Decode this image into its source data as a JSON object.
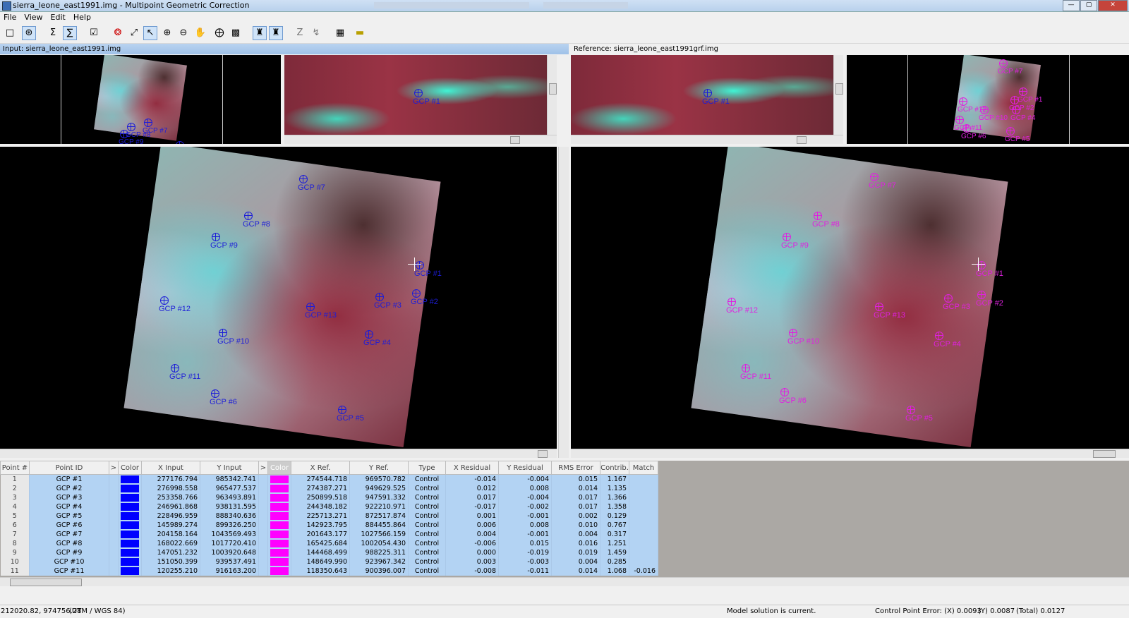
{
  "window": {
    "title": "sierra_leone_east1991.img - Multipoint Geometric Correction"
  },
  "menu": [
    "File",
    "View",
    "Edit",
    "Help"
  ],
  "toolbar_icons": [
    "new-window-icon",
    "viewer-sync-icon",
    "sum-icon",
    "model-properties-icon",
    "check-icon",
    "gcp-color-icon",
    "fit-icon",
    "select-arrow-icon",
    "zoom-in-icon",
    "zoom-out-icon",
    "pan-hand-icon",
    "create-gcp-icon",
    "lock-icon",
    "drive-to-input-icon",
    "drive-to-reference-icon",
    "z-value-icon",
    "z-options-icon",
    "table-icon",
    "measure-icon"
  ],
  "panels": {
    "input_header": "Input: sierra_leone_east1991.img",
    "reference_header": "Reference: sierra_leone_east1991grf.img"
  },
  "gcps": {
    "main_left": [
      {
        "label": "GCP #1"
      },
      {
        "label": "GCP #2"
      },
      {
        "label": "GCP #3"
      },
      {
        "label": "GCP #4"
      },
      {
        "label": "GCP #5"
      },
      {
        "label": "GCP #6"
      },
      {
        "label": "GCP #7"
      },
      {
        "label": "GCP #8"
      },
      {
        "label": "GCP #9"
      },
      {
        "label": "GCP #10"
      },
      {
        "label": "GCP #11"
      },
      {
        "label": "GCP #12"
      },
      {
        "label": "GCP #13"
      }
    ],
    "zoom_label": "GCP #1"
  },
  "table": {
    "headers": [
      "Point #",
      "Point ID",
      ">",
      "Color",
      "X Input",
      "Y Input",
      ">",
      "Color",
      "X Ref.",
      "Y Ref.",
      "Type",
      "X Residual",
      "Y Residual",
      "RMS Error",
      "Contrib.",
      "Match"
    ],
    "input_color": "#0000ff",
    "ref_color": "#ff00ff",
    "rows": [
      {
        "n": "1",
        "id": "GCP #1",
        "xi": "277176.794",
        "yi": "985342.741",
        "xr": "274544.718",
        "yr": "969570.782",
        "type": "Control",
        "xres": "-0.014",
        "yres": "-0.004",
        "rms": "0.015",
        "contrib": "1.167",
        "match": ""
      },
      {
        "n": "2",
        "id": "GCP #2",
        "xi": "276998.558",
        "yi": "965477.537",
        "xr": "274387.271",
        "yr": "949629.525",
        "type": "Control",
        "xres": "0.012",
        "yres": "0.008",
        "rms": "0.014",
        "contrib": "1.135",
        "match": ""
      },
      {
        "n": "3",
        "id": "GCP #3",
        "xi": "253358.766",
        "yi": "963493.891",
        "xr": "250899.518",
        "yr": "947591.332",
        "type": "Control",
        "xres": "0.017",
        "yres": "-0.004",
        "rms": "0.017",
        "contrib": "1.366",
        "match": ""
      },
      {
        "n": "4",
        "id": "GCP #4",
        "xi": "246961.868",
        "yi": "938131.595",
        "xr": "244348.182",
        "yr": "922210.971",
        "type": "Control",
        "xres": "-0.017",
        "yres": "-0.002",
        "rms": "0.017",
        "contrib": "1.358",
        "match": ""
      },
      {
        "n": "5",
        "id": "GCP #5",
        "xi": "228496.959",
        "yi": "888340.636",
        "xr": "225713.271",
        "yr": "872517.874",
        "type": "Control",
        "xres": "0.001",
        "yres": "-0.001",
        "rms": "0.002",
        "contrib": "0.129",
        "match": ""
      },
      {
        "n": "6",
        "id": "GCP #6",
        "xi": "145989.274",
        "yi": "899326.250",
        "xr": "142923.795",
        "yr": "884455.864",
        "type": "Control",
        "xres": "0.006",
        "yres": "0.008",
        "rms": "0.010",
        "contrib": "0.767",
        "match": ""
      },
      {
        "n": "7",
        "id": "GCP #7",
        "xi": "204158.164",
        "yi": "1043569.493",
        "xr": "201643.177",
        "yr": "1027566.159",
        "type": "Control",
        "xres": "0.004",
        "yres": "-0.001",
        "rms": "0.004",
        "contrib": "0.317",
        "match": ""
      },
      {
        "n": "8",
        "id": "GCP #8",
        "xi": "168022.669",
        "yi": "1017720.410",
        "xr": "165425.684",
        "yr": "1002054.430",
        "type": "Control",
        "xres": "-0.006",
        "yres": "0.015",
        "rms": "0.016",
        "contrib": "1.251",
        "match": ""
      },
      {
        "n": "9",
        "id": "GCP #9",
        "xi": "147051.232",
        "yi": "1003920.648",
        "xr": "144468.499",
        "yr": "988225.311",
        "type": "Control",
        "xres": "0.000",
        "yres": "-0.019",
        "rms": "0.019",
        "contrib": "1.459",
        "match": ""
      },
      {
        "n": "10",
        "id": "GCP #10",
        "xi": "151050.399",
        "yi": "939537.491",
        "xr": "148649.990",
        "yr": "923967.342",
        "type": "Control",
        "xres": "0.003",
        "yres": "-0.003",
        "rms": "0.004",
        "contrib": "0.285",
        "match": ""
      },
      {
        "n": "11",
        "id": "GCP #11",
        "xi": "120255.210",
        "yi": "916163.200",
        "xr": "118350.643",
        "yr": "900396.007",
        "type": "Control",
        "xres": "-0.008",
        "yres": "-0.011",
        "rms": "0.014",
        "contrib": "1.068",
        "match": "-0.016"
      }
    ]
  },
  "status": {
    "coords": "212020.82, 974756.28",
    "projection": "(UTM / WGS 84)",
    "model": "Model solution is current.",
    "cpe_label": "Control Point Error: (X) 0.0093",
    "cpe_y": "(Y) 0.0087",
    "cpe_total": "(Total) 0.0127"
  }
}
